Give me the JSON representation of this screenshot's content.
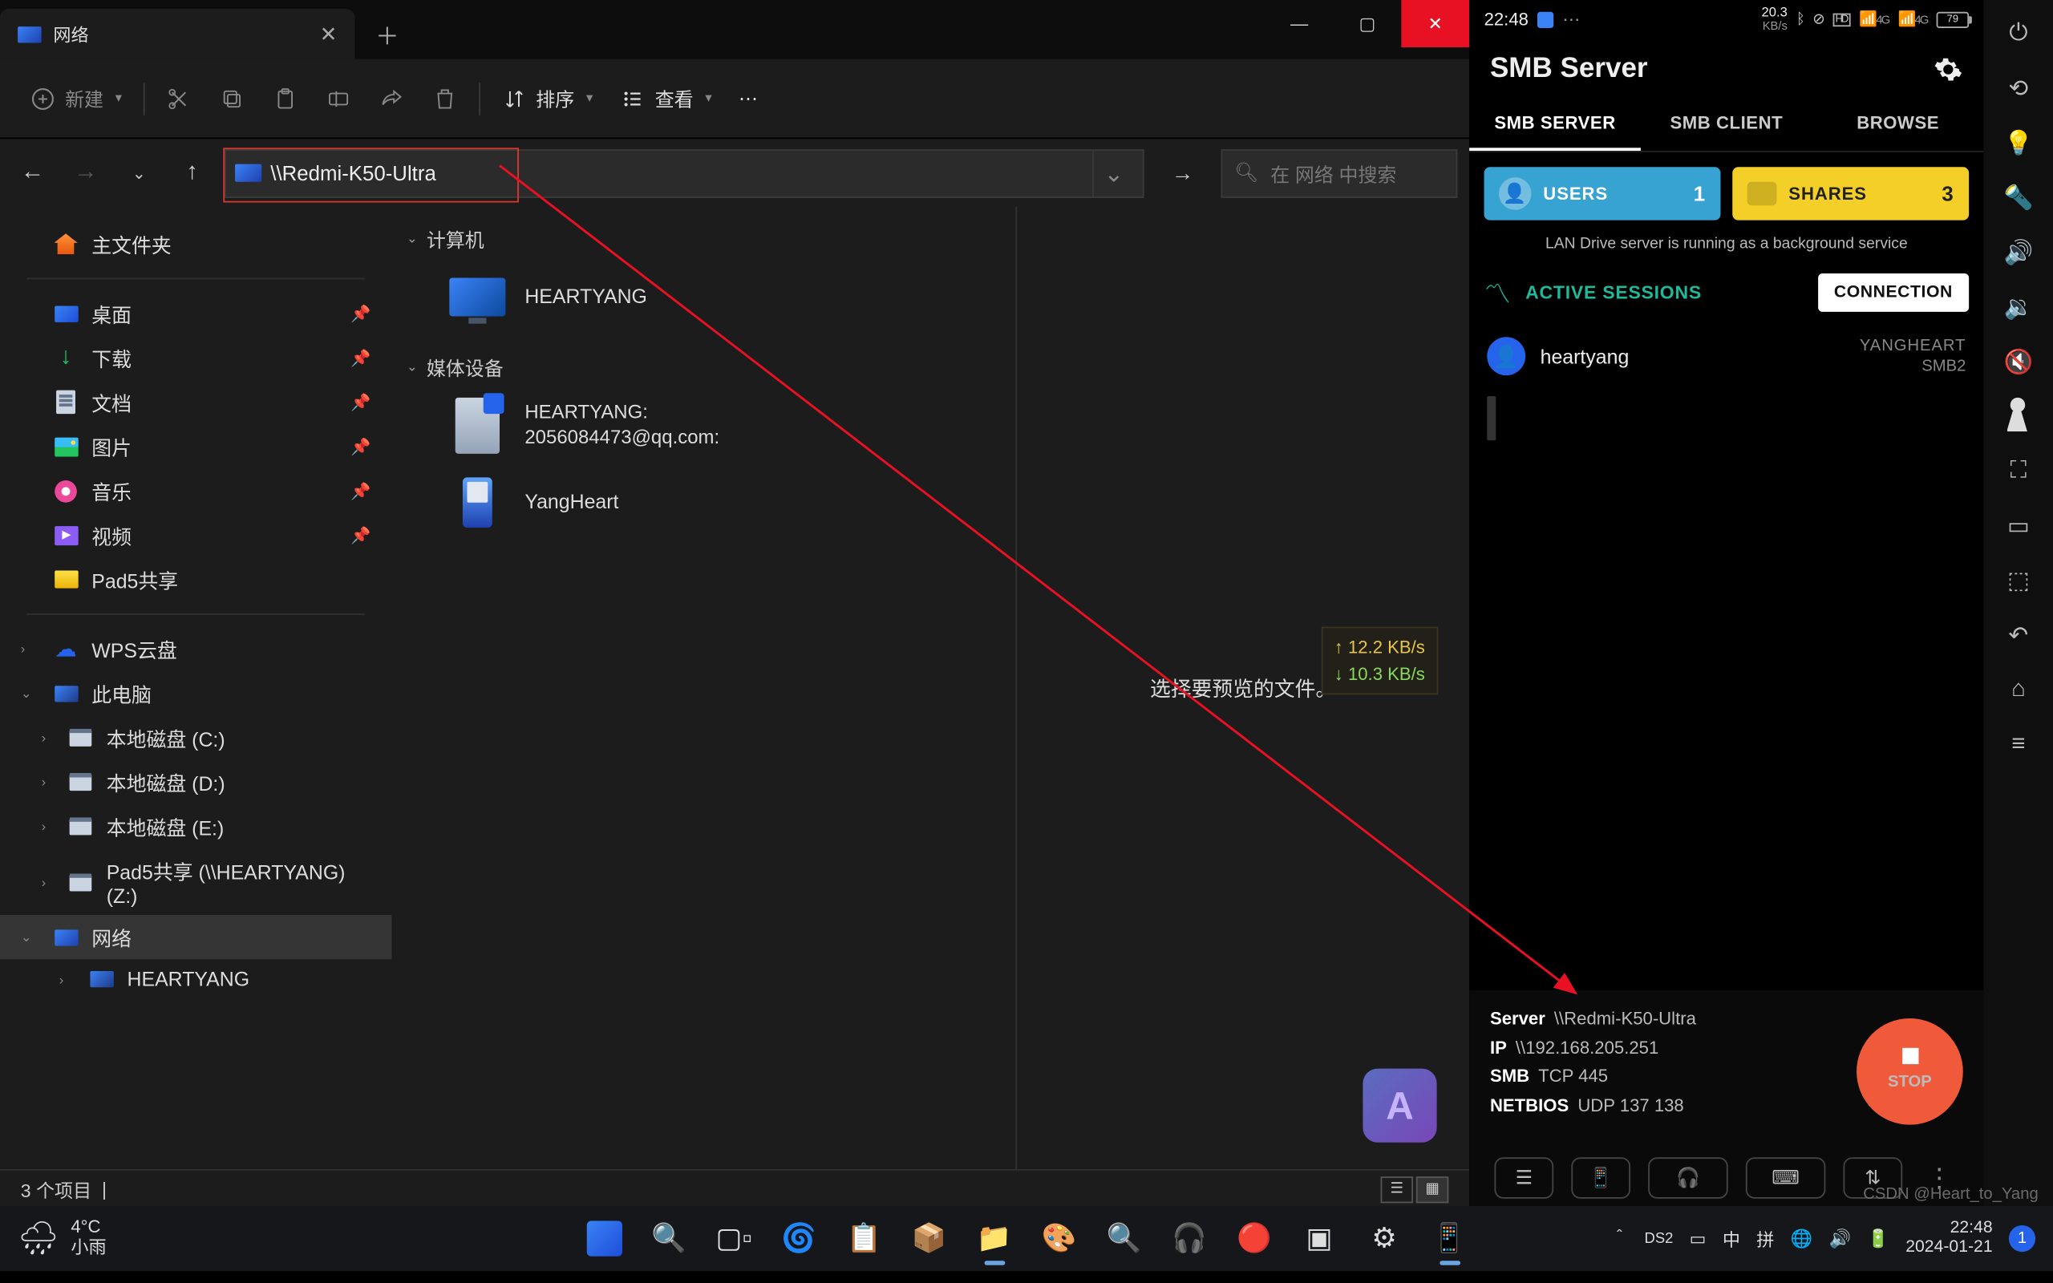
{
  "explorer": {
    "tab_title": "网络",
    "toolbar": {
      "new": "新建",
      "sort": "排序",
      "view": "查看"
    },
    "address": "\\\\Redmi-K50-Ultra",
    "search_placeholder": "在 网络 中搜索",
    "sidebar": {
      "home": "主文件夹",
      "quick": [
        "桌面",
        "下载",
        "文档",
        "图片",
        "音乐",
        "视频",
        "Pad5共享"
      ],
      "wps": "WPS云盘",
      "thispc": "此电脑",
      "drives": [
        "本地磁盘 (C:)",
        "本地磁盘 (D:)",
        "本地磁盘 (E:)",
        "Pad5共享 (\\\\HEARTYANG) (Z:)"
      ],
      "network": "网络",
      "net_items": [
        "HEARTYANG"
      ]
    },
    "groups": {
      "computer": {
        "label": "计算机",
        "items": [
          "HEARTYANG"
        ]
      },
      "media": {
        "label": "媒体设备",
        "items": [
          {
            "l1": "HEARTYANG:",
            "l2": "2056084473@qq.com:"
          },
          {
            "l1": "YangHeart"
          }
        ]
      }
    },
    "preview_hint": "选择要预览的文件。",
    "net_overlay": {
      "up": "12.2 KB/s",
      "down": "10.3 KB/s"
    },
    "status": "3 个项目"
  },
  "phone": {
    "status_time": "22:48",
    "battery": "79",
    "kbs": "20.3",
    "app_title": "SMB Server",
    "tabs": [
      "SMB SERVER",
      "SMB CLIENT",
      "BROWSE"
    ],
    "users": {
      "label": "USERS",
      "count": "1"
    },
    "shares": {
      "label": "SHARES",
      "count": "3"
    },
    "bg_msg": "LAN Drive server is running as a background service",
    "active_sessions": "ACTIVE SESSIONS",
    "connection": "CONNECTION",
    "session": {
      "name": "heartyang",
      "host": "YANGHEART",
      "proto": "SMB2"
    },
    "footer": {
      "server": {
        "k": "Server",
        "v": "\\\\Redmi-K50-Ultra"
      },
      "ip": {
        "k": "IP",
        "v": "\\\\192.168.205.251"
      },
      "smb": {
        "k": "SMB",
        "v": "TCP 445"
      },
      "netbios": {
        "k": "NETBIOS",
        "v": "UDP 137 138"
      }
    },
    "stop": "STOP"
  },
  "taskbar": {
    "weather": {
      "temp": "4°C",
      "desc": "小雨"
    },
    "tray": {
      "ds2": "DS2",
      "cn": "中",
      "pin": "拼"
    },
    "clock": {
      "time": "22:48",
      "date": "2024-01-21"
    },
    "noti": "1"
  },
  "watermark": "CSDN @Heart_to_Yang"
}
